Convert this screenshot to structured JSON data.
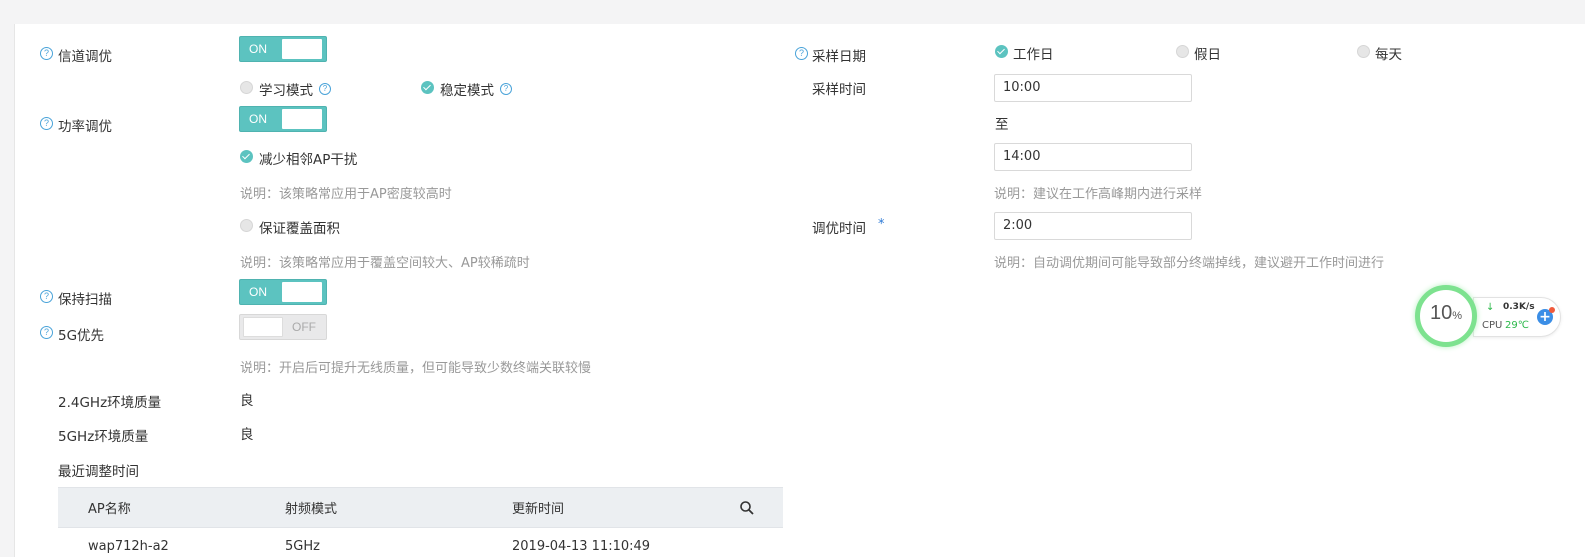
{
  "left": {
    "channel_tuning": {
      "label": "信道调优",
      "toggle": "ON"
    },
    "modes": {
      "learn": "学习模式",
      "stable": "稳定模式"
    },
    "power_tuning": {
      "label": "功率调优",
      "toggle": "ON"
    },
    "reduce_interference": "减少相邻AP干扰",
    "reduce_note": "说明：该策略常应用于AP密度较高时",
    "ensure_coverage": "保证覆盖面积",
    "coverage_note": "说明：该策略常应用于覆盖空间较大、AP较稀疏时",
    "keep_scan": {
      "label": "保持扫描",
      "toggle": "ON"
    },
    "prefer_5g": {
      "label": "5G优先",
      "toggle": "OFF"
    },
    "prefer_note": "说明：开启后可提升无线质量，但可能导致少数终端关联较慢",
    "env24": {
      "label": "2.4GHz环境质量",
      "value": "良"
    },
    "env5": {
      "label": "5GHz环境质量",
      "value": "良"
    },
    "recent_label": "最近调整时间"
  },
  "right": {
    "sample_date_label": "采样日期",
    "days": {
      "workday": "工作日",
      "holiday": "假日",
      "everyday": "每天"
    },
    "sample_time_label": "采样时间",
    "start_time": "10:00",
    "to": "至",
    "end_time": "14:00",
    "sample_note": "说明：建议在工作高峰期内进行采样",
    "tune_time_label": "调优时间",
    "required_mark": "*",
    "tune_time": "2:00",
    "tune_note": "说明：自动调优期间可能导致部分终端掉线，建议避开工作时间进行"
  },
  "table": {
    "headers": [
      "AP名称",
      "射频模式",
      "更新时间"
    ],
    "rows": [
      [
        "wap712h-a2",
        "5GHz",
        "2019-04-13 11:10:49"
      ]
    ]
  },
  "widget": {
    "percent": "10",
    "percent_unit": "%",
    "speed": "0.3K/s",
    "cpu_label": "CPU",
    "cpu_temp": "29℃"
  },
  "colors": {
    "accent": "#5cc3c0",
    "help": "#4aa3d9",
    "note": "#999999"
  }
}
